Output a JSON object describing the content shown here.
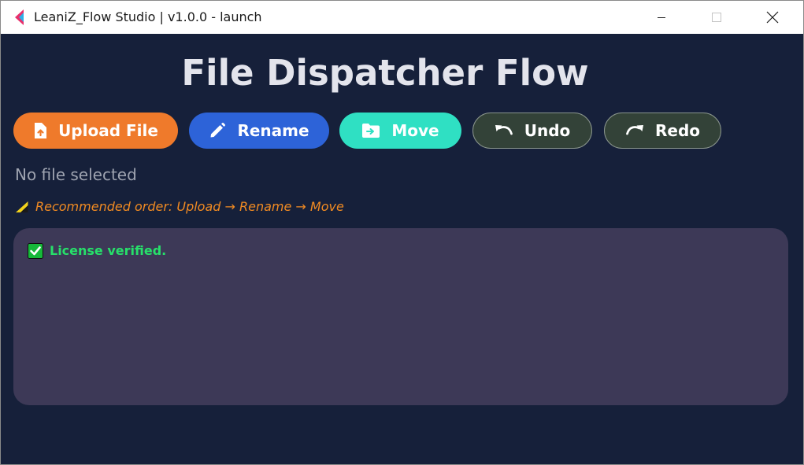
{
  "window": {
    "title": "LeaniZ_Flow Studio | v1.0.0 - launch"
  },
  "header": {
    "title": "File Dispatcher Flow"
  },
  "toolbar": {
    "upload_label": "Upload File",
    "rename_label": "Rename",
    "move_label": "Move",
    "undo_label": "Undo",
    "redo_label": "Redo"
  },
  "status": {
    "file": "No file selected",
    "hint": "Recommended order: Upload → Rename → Move"
  },
  "log": {
    "lines": [
      "License verified."
    ]
  },
  "colors": {
    "background": "#16203a",
    "upload": "#ef7a2b",
    "rename": "#2d63d8",
    "move": "#2fe0c3",
    "undo_redo": "#334238",
    "panel": "#3d3957",
    "success": "#27e06a",
    "hint": "#f08a22"
  },
  "icons": {
    "upload": "file-upload-icon",
    "rename": "pencil-icon",
    "move": "folder-move-icon",
    "undo": "undo-icon",
    "redo": "redo-icon",
    "hint": "warning-icon",
    "log": "checkbox-checked-icon"
  }
}
